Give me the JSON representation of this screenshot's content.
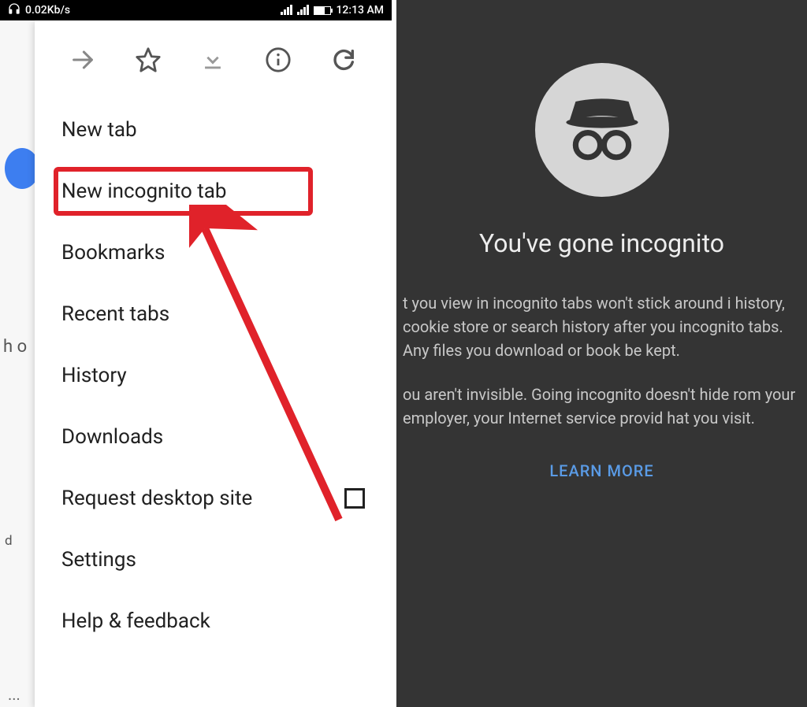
{
  "status_bar": {
    "data_rate": "0.02Kb/s",
    "time": "12:13 AM"
  },
  "left_background": {
    "partial_text_1": "h o",
    "partial_text_2": "d"
  },
  "menu": {
    "items": [
      {
        "label": "New tab"
      },
      {
        "label": "New incognito tab"
      },
      {
        "label": "Bookmarks"
      },
      {
        "label": "Recent tabs"
      },
      {
        "label": "History"
      },
      {
        "label": "Downloads"
      },
      {
        "label": "Request desktop site"
      },
      {
        "label": "Settings"
      },
      {
        "label": "Help & feedback"
      }
    ]
  },
  "incognito": {
    "title": "You've gone incognito",
    "para1": "t you view in incognito tabs won't stick around i history, cookie store or search history after you incognito tabs. Any files you download or book be kept.",
    "para2": "ou aren't invisible. Going incognito doesn't hide rom your employer, your Internet service provid hat you visit.",
    "learn_more": "LEARN MORE"
  }
}
